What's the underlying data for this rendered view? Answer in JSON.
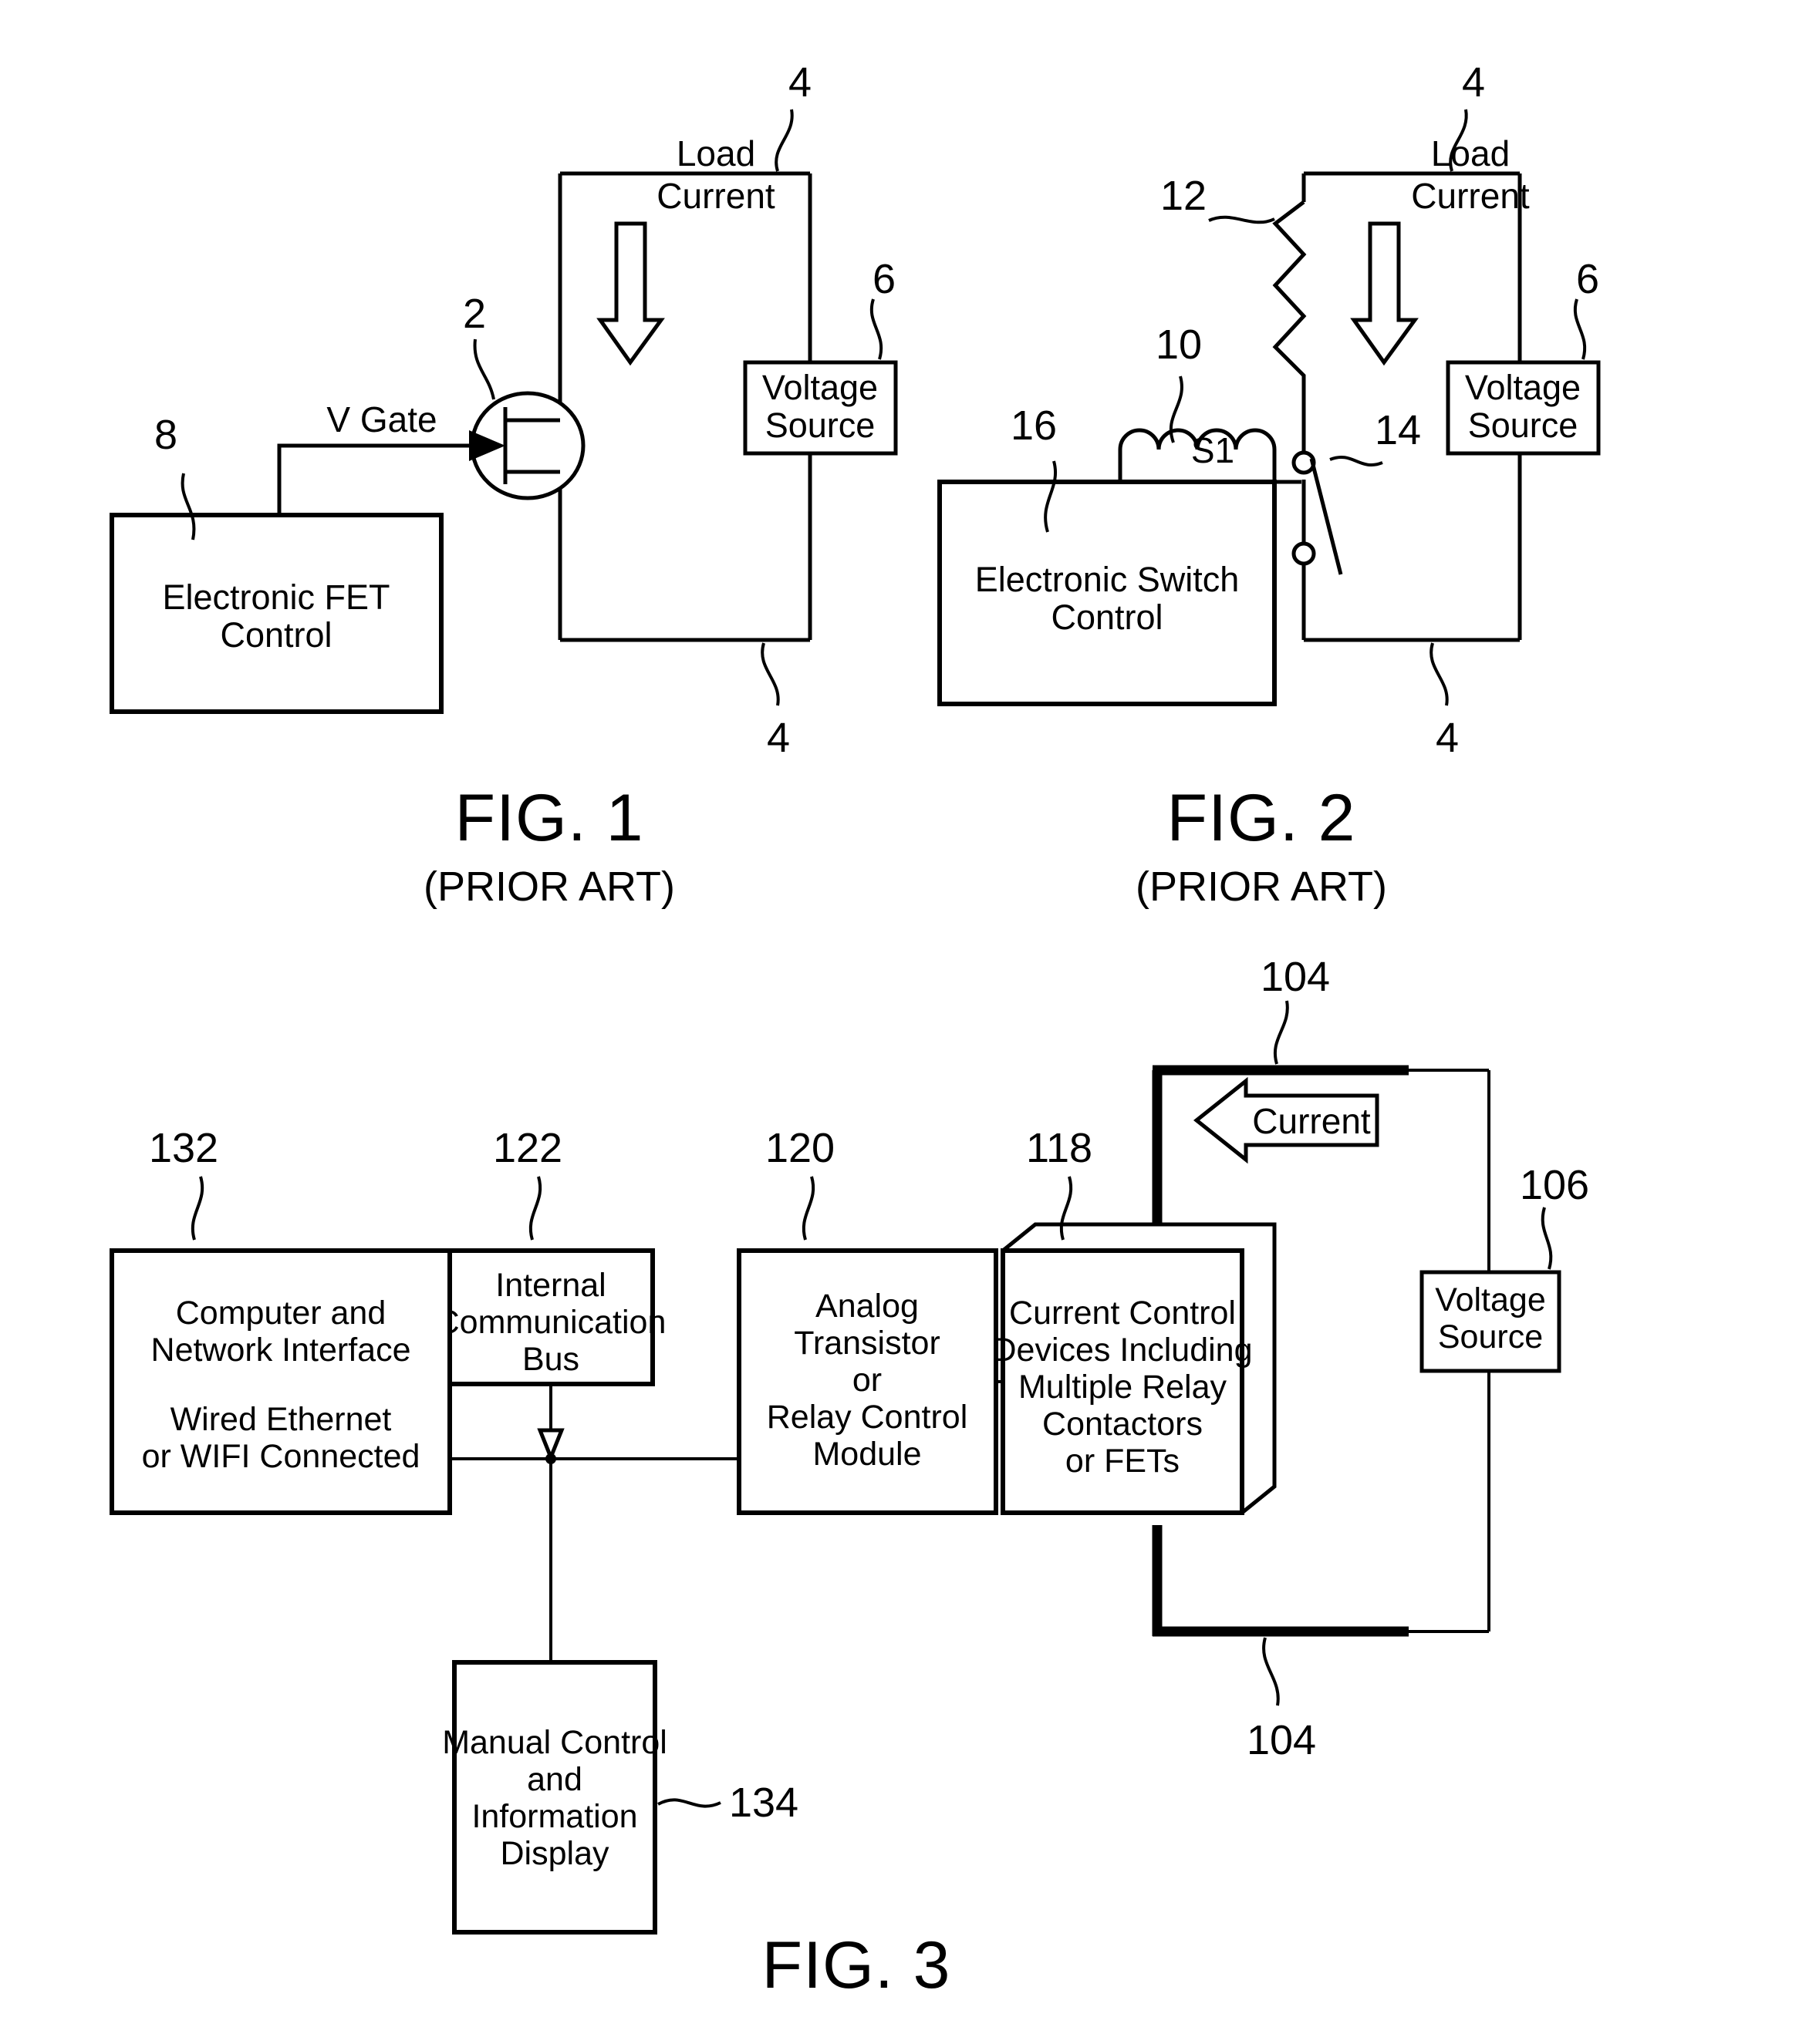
{
  "figures": [
    {
      "id": "fig1",
      "title": "FIG. 1",
      "subtitle": "(PRIOR ART)",
      "refs": {
        "fet": "2",
        "loop_top": "4",
        "loop_bottom": "4",
        "source": "6",
        "control": "8"
      },
      "labels": {
        "v_gate": "V Gate",
        "load_current_l1": "Load",
        "load_current_l2": "Current"
      },
      "blocks": {
        "voltage_source_l1": "Voltage",
        "voltage_source_l2": "Source",
        "fet_control_l1": "Electronic FET",
        "fet_control_l2": "Control"
      }
    },
    {
      "id": "fig2",
      "title": "FIG. 2",
      "subtitle": "(PRIOR ART)",
      "refs": {
        "coil": "10",
        "resistor": "12",
        "contact": "14",
        "control": "16",
        "loop_top": "4",
        "loop_bottom": "4",
        "source": "6"
      },
      "labels": {
        "switch": "S1",
        "load_current_l1": "Load",
        "load_current_l2": "Current"
      },
      "blocks": {
        "voltage_source_l1": "Voltage",
        "voltage_source_l2": "Source",
        "switch_control_l1": "Electronic Switch",
        "switch_control_l2": "Control"
      }
    },
    {
      "id": "fig3",
      "title": "FIG. 3",
      "subtitle": "",
      "refs": {
        "computer": "132",
        "bus": "122",
        "relay_module": "120",
        "current_devices": "118",
        "bus_bar_top": "104",
        "bus_bar_bottom": "104",
        "source": "106",
        "display": "134"
      },
      "labels": {
        "current": "Current"
      },
      "blocks": {
        "computer_l1": "Computer and",
        "computer_l2": "Network Interface",
        "computer_l3": "Wired Ethernet",
        "computer_l4": "or WIFI Connected",
        "bus_l1": "Internal",
        "bus_l2": "Communication",
        "bus_l3": "Bus",
        "relay_l1": "Analog",
        "relay_l2": "Transistor",
        "relay_l3": "or",
        "relay_l4": "Relay Control",
        "relay_l5": "Module",
        "devices_l1": "Current Control",
        "devices_l2": "Devices Including",
        "devices_l3": "Multiple Relay",
        "devices_l4": "Contactors",
        "devices_l5": "or FETs",
        "voltage_source_l1": "Voltage",
        "voltage_source_l2": "Source",
        "display_l1": "Manual Control",
        "display_l2": "and",
        "display_l3": "Information",
        "display_l4": "Display"
      }
    }
  ],
  "colors": {
    "ink": "#000000",
    "paper": "#ffffff"
  }
}
